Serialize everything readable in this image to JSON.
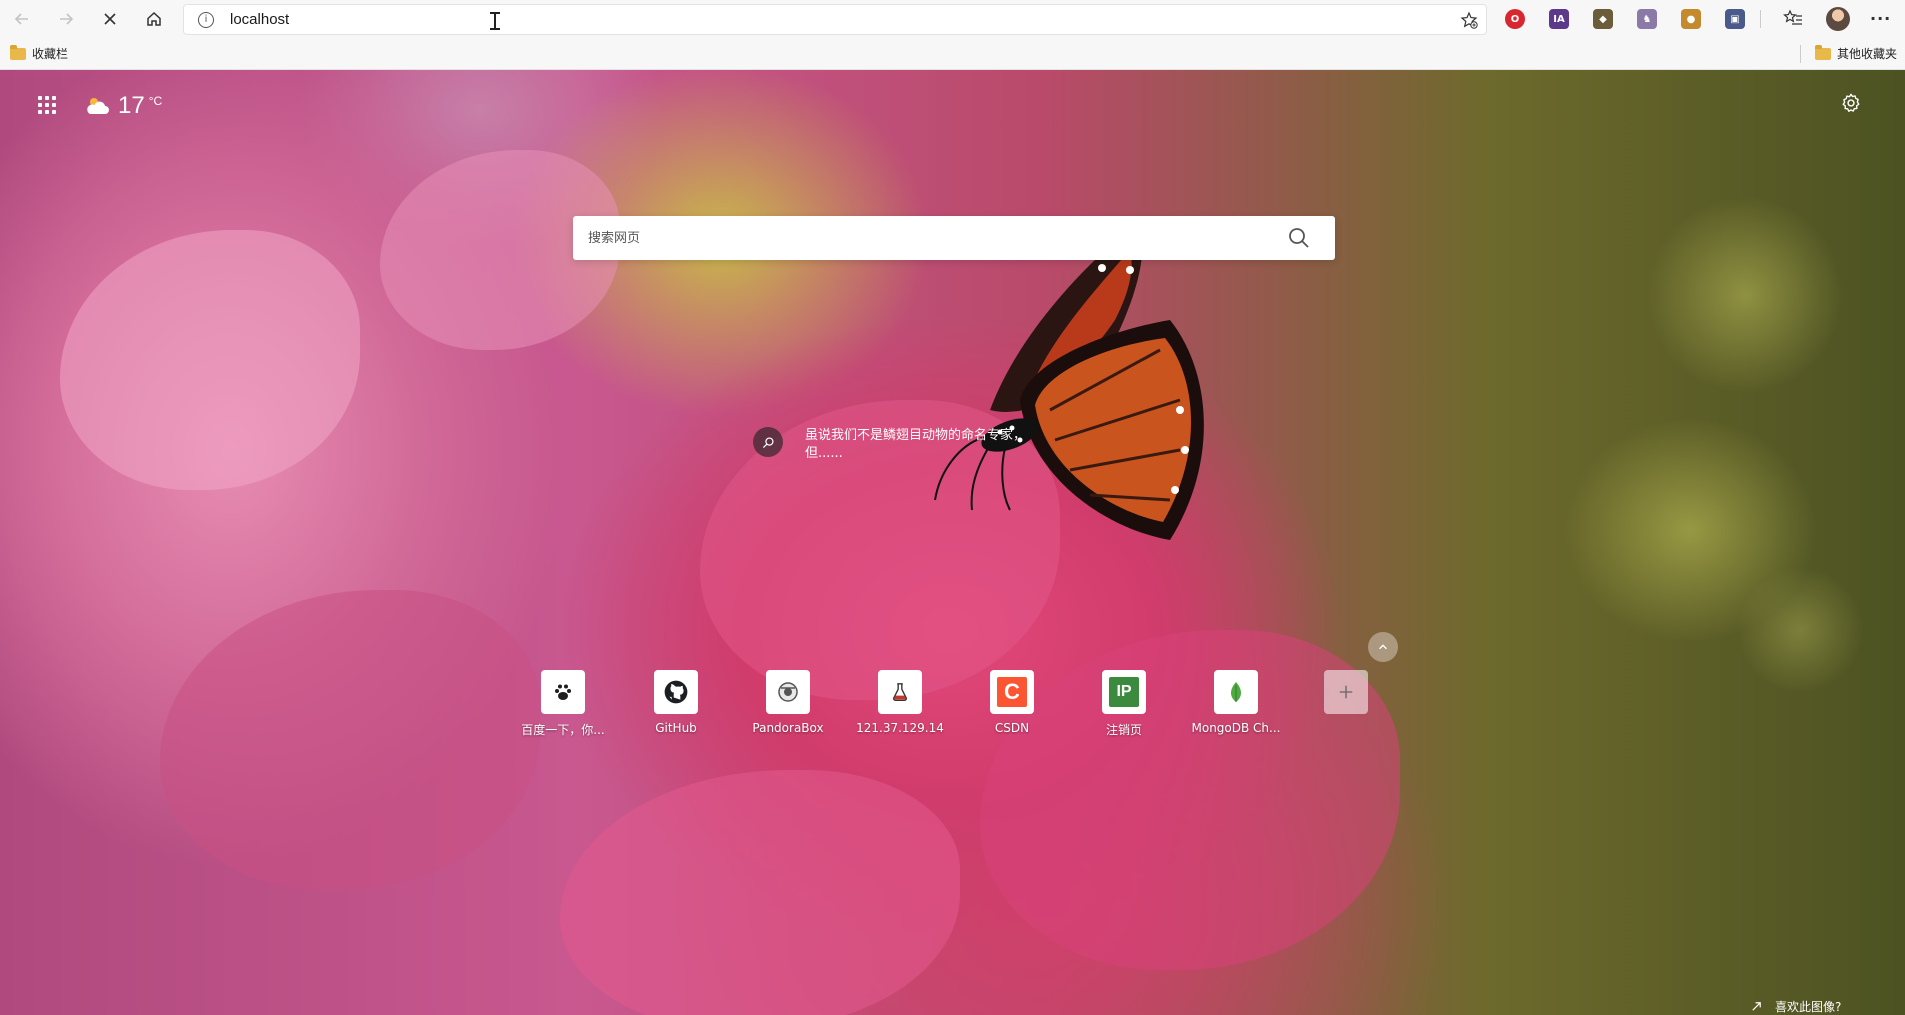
{
  "browser": {
    "url": "localhost",
    "extensions": [
      {
        "name": "red-shield-icon",
        "color": "#d7282f",
        "glyph": "O"
      },
      {
        "name": "ia-icon",
        "color": "#5b3a8c",
        "glyph": "IA"
      },
      {
        "name": "cube-icon",
        "color": "#6b5c3a",
        "glyph": "◆"
      },
      {
        "name": "unicorn-icon",
        "color": "#8b7aa8",
        "glyph": "♞"
      },
      {
        "name": "lock-icon",
        "color": "#c48a2e",
        "glyph": "●"
      },
      {
        "name": "puzzle-icon",
        "color": "#4a5a8a",
        "glyph": "▣"
      }
    ]
  },
  "bookmarks": {
    "left_folder": "收藏栏",
    "right_folder": "其他收藏夹"
  },
  "weather": {
    "temperature": "17",
    "unit": "°C"
  },
  "search": {
    "placeholder": "搜索网页"
  },
  "fact": {
    "line1": "虽说我们不是鳞翅目动物的命名专家，",
    "line2": "但......"
  },
  "quick_links": [
    {
      "label": "百度一下，你...",
      "icon": "baidu-paw-icon",
      "color": "#2932e1"
    },
    {
      "label": "GitHub",
      "icon": "github-icon",
      "color": "#1b1f23"
    },
    {
      "label": "PandoraBox",
      "icon": "pandora-icon",
      "color": "#555555"
    },
    {
      "label": "121.37.129.14",
      "icon": "flask-icon",
      "color": "#c0392b"
    },
    {
      "label": "CSDN",
      "icon": "csdn-icon",
      "color": "#fc5531"
    },
    {
      "label": "注销页",
      "icon": "ip-icon",
      "color": "#3b8a3e"
    },
    {
      "label": "MongoDB Ch...",
      "icon": "mongodb-leaf-icon",
      "color": "#4faa41"
    },
    {
      "label": "",
      "icon": "add-icon",
      "color": "#ffffff"
    }
  ],
  "bing": {
    "question": "喜欢此图像?"
  }
}
